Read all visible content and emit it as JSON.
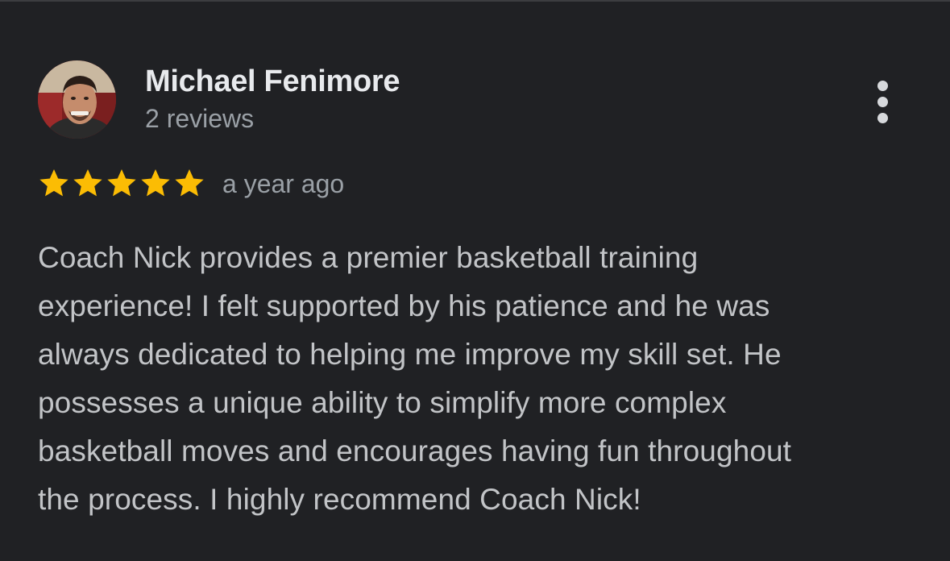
{
  "review": {
    "author": {
      "name": "Michael Fenimore",
      "reviews_count": "2 reviews",
      "avatar": "profile-photo"
    },
    "more_icon": "more-vertical-icon",
    "rating": 5,
    "rating_max": 5,
    "star_color": "#fbbc04",
    "date": "a year ago",
    "text_lines": [
      "Coach Nick provides a premier basketball training",
      "experience! I felt supported by his patience and he was",
      "always dedicated to helping me improve my skill set. He",
      "possesses a unique ability to simplify more complex",
      "basketball moves and encourages having fun throughout",
      "the process. I highly recommend Coach Nick!"
    ]
  },
  "colors": {
    "background": "#202124",
    "name_text": "#e8eaed",
    "secondary_text": "#9aa0a6",
    "body_text": "#c2c4c7"
  }
}
